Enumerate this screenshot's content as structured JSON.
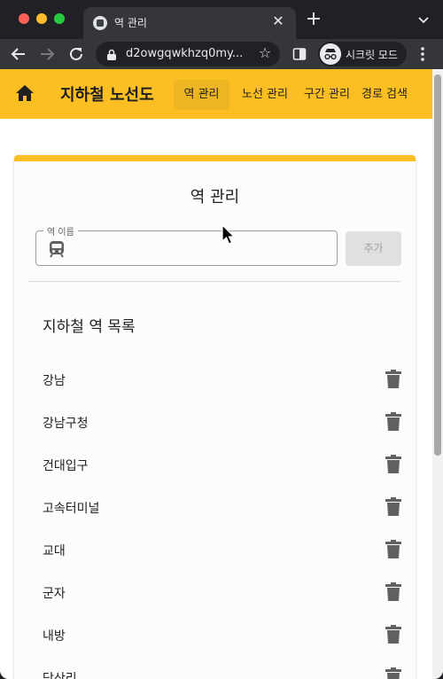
{
  "browser": {
    "tab_title": "역 관리",
    "url": "d2owgqwkhzq0my...",
    "incognito_label": "시크릿 모드"
  },
  "app": {
    "brand": "지하철 노선도",
    "nav": [
      {
        "label": "역 관리",
        "active": true
      },
      {
        "label": "노선 관리",
        "active": false
      },
      {
        "label": "구간 관리",
        "active": false
      },
      {
        "label": "경로 검색",
        "active": false
      }
    ]
  },
  "station_form": {
    "title": "역 관리",
    "field_label": "역 이름",
    "value": "",
    "add_label": "추가"
  },
  "station_list": {
    "title": "지하철 역 목록",
    "items": [
      "강남",
      "강남구청",
      "건대입구",
      "고속터미널",
      "교대",
      "군자",
      "내방",
      "당산리"
    ]
  },
  "colors": {
    "accent": "#fbbf24",
    "card_bg": "#fdfbfe",
    "icon": "#616161"
  }
}
